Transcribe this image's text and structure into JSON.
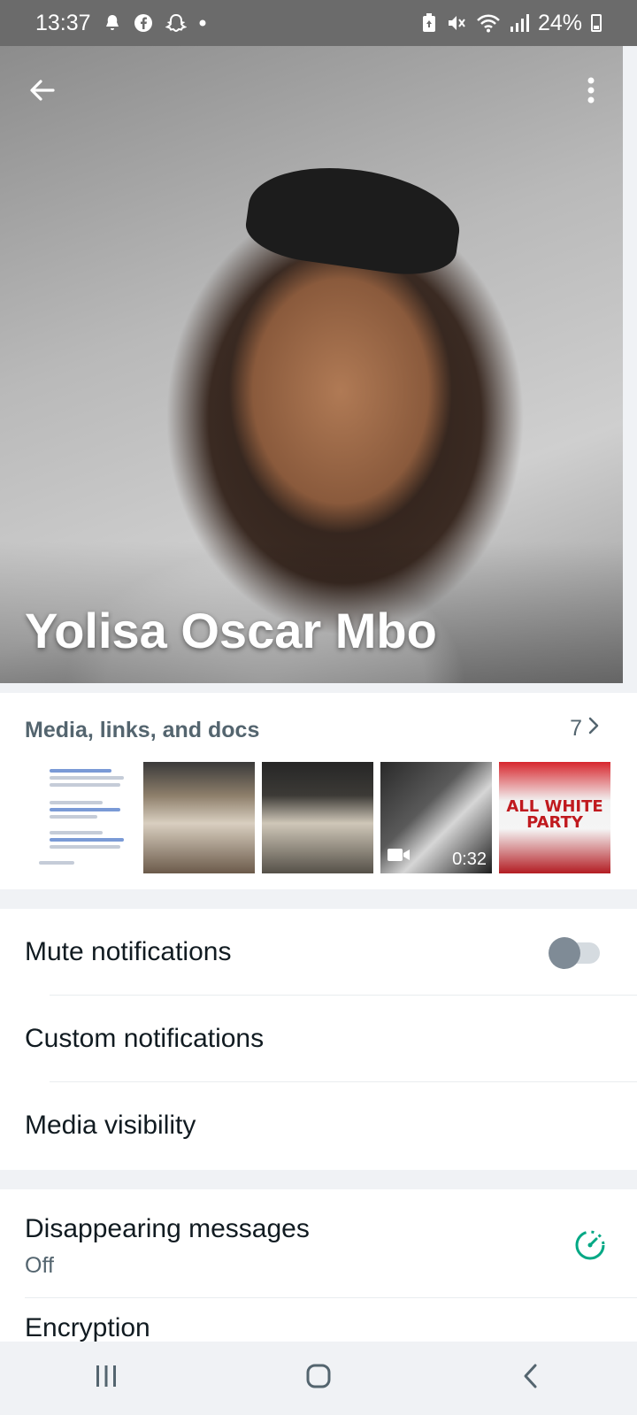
{
  "status_bar": {
    "time": "13:37",
    "battery_percent": "24%",
    "left_icons": [
      "notification-icon",
      "facebook-icon",
      "snapchat-icon",
      "dot-icon"
    ],
    "right_icons": [
      "battery-saver-icon",
      "mute-icon",
      "wifi-icon",
      "signal-icon",
      "battery-icon"
    ]
  },
  "header": {
    "back_icon": "arrow-left-icon",
    "menu_icon": "more-vert-icon"
  },
  "profile": {
    "name": "Yolisa Oscar Mbo"
  },
  "media": {
    "heading": "Media, links, and docs",
    "count": "7",
    "thumbnails": [
      {
        "kind": "screenshot"
      },
      {
        "kind": "photo"
      },
      {
        "kind": "photo"
      },
      {
        "kind": "video",
        "duration": "0:32"
      },
      {
        "kind": "poster",
        "text": "ALL WHITE PARTY"
      }
    ]
  },
  "settings": {
    "mute_notifications": "Mute notifications",
    "mute_enabled": false,
    "custom_notifications": "Custom notifications",
    "media_visibility": "Media visibility"
  },
  "privacy": {
    "disappearing_title": "Disappearing messages",
    "disappearing_value": "Off",
    "encryption_title": "Encryption"
  },
  "colors": {
    "accent": "#00a884",
    "secondary_text": "#54656f",
    "toggle_off": "#7f8b96"
  }
}
